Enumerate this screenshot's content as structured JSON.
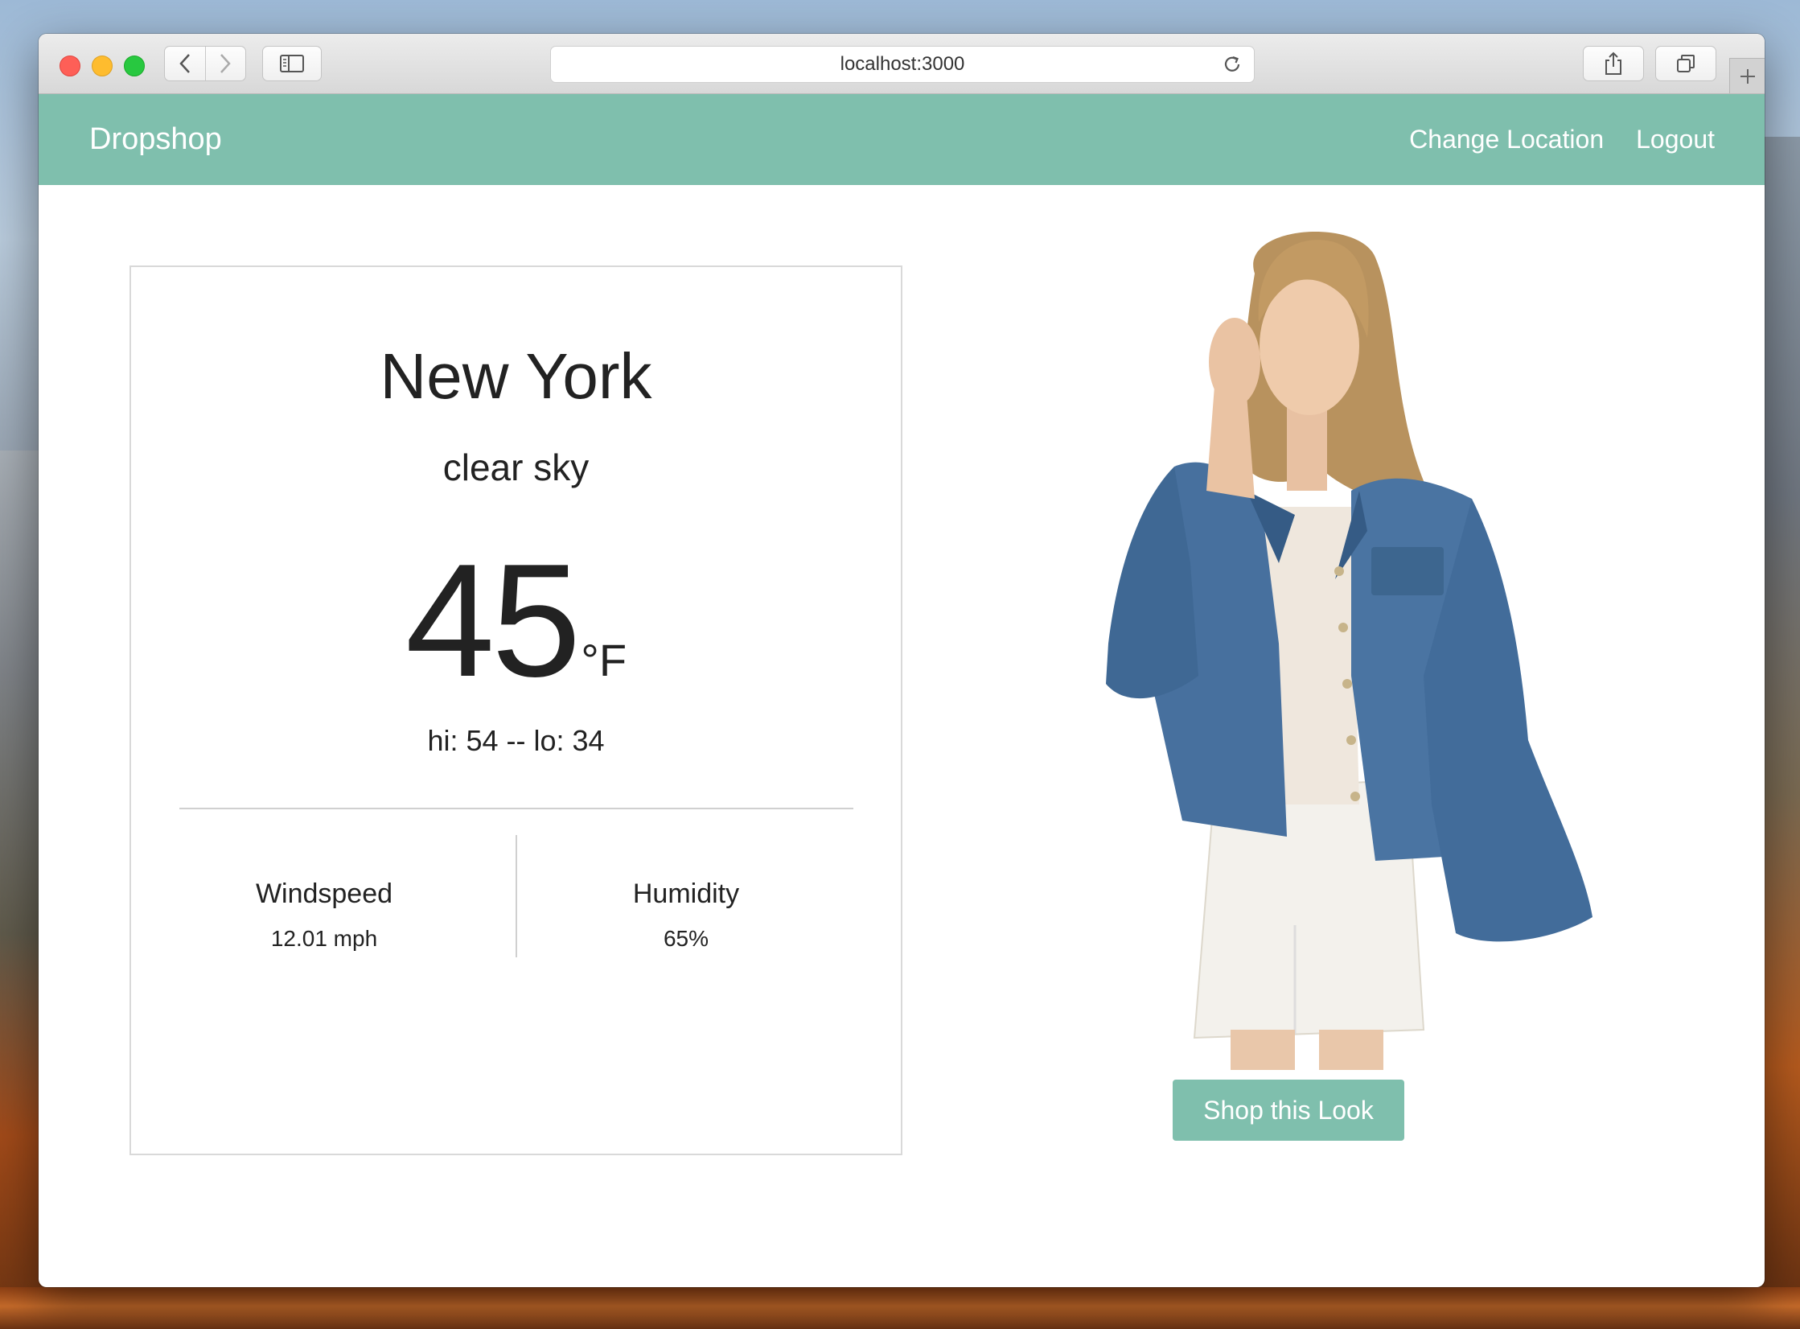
{
  "browser": {
    "url": "localhost:3000"
  },
  "navbar": {
    "brand": "Dropshop",
    "links": [
      "Change Location",
      "Logout"
    ],
    "color": "#7fbfad"
  },
  "weather": {
    "city": "New York",
    "condition": "clear sky",
    "temperature": "45",
    "unit": "°F",
    "hilo": "hi: 54 -- lo: 34",
    "windspeed_label": "Windspeed",
    "windspeed_value": "12.01 mph",
    "humidity_label": "Humidity",
    "humidity_value": "65%"
  },
  "outfit": {
    "image": "model wearing oversized denim jacket with bell sleeves, white top and white denim skirt",
    "shop_button": "Shop this Look"
  }
}
